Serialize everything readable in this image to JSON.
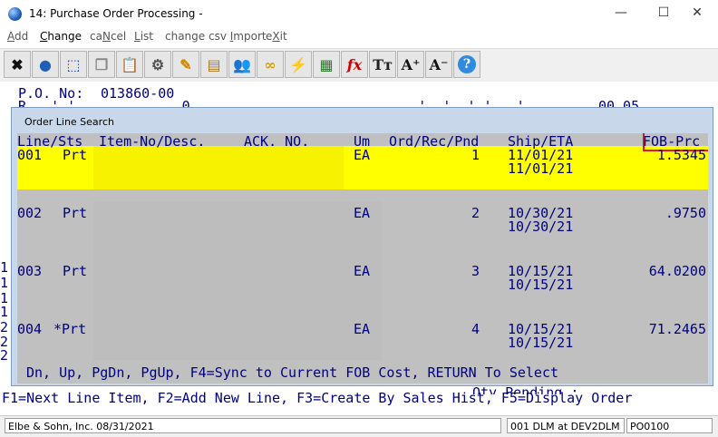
{
  "window": {
    "title": "14: Purchase Order Processing -",
    "minimize": "—",
    "maximize": "☐",
    "close": "✕"
  },
  "menu": [
    {
      "hot": "A",
      "rest": "dd"
    },
    {
      "hot": "C",
      "rest": "hange"
    },
    {
      "pre": "ca",
      "hot": "N",
      "rest": "cel"
    },
    {
      "hot": "L",
      "rest": "ist"
    },
    {
      "pre": "change csv ",
      "hot": "I",
      "rest": "mport"
    },
    {
      "pre": "e",
      "hot": "X",
      "rest": "it"
    }
  ],
  "toolbar": [
    {
      "name": "close-x-icon",
      "glyph": "✖",
      "color": "#111111"
    },
    {
      "name": "globe-icon",
      "glyph": "●",
      "color": "#1f5fb8"
    },
    {
      "name": "select-region-icon",
      "glyph": "⬚",
      "color": "#1a3fa8"
    },
    {
      "name": "copy-icon",
      "glyph": "❐",
      "color": "#888888"
    },
    {
      "name": "paste-icon",
      "glyph": "📋",
      "color": "#8a6a3a"
    },
    {
      "name": "gear-icon",
      "glyph": "⚙",
      "color": "#555555"
    },
    {
      "name": "pencil-icon",
      "glyph": "✎",
      "color": "#d48a00"
    },
    {
      "name": "notepad-icon",
      "glyph": "▤",
      "color": "#b07a20"
    },
    {
      "name": "users-icon",
      "glyph": "👥",
      "color": "#2d7fd0"
    },
    {
      "name": "chain-link-icon",
      "glyph": "∞",
      "color": "#d4a000"
    },
    {
      "name": "lightning-icon",
      "glyph": "⚡",
      "color": "#e0c000"
    },
    {
      "name": "spreadsheet-icon",
      "glyph": "▦",
      "color": "#2a7a2a"
    },
    {
      "name": "function-fx-icon",
      "glyph": "fx",
      "color": "#d00000"
    },
    {
      "name": "font-size-icon",
      "glyph": "Tт",
      "color": "#222222"
    },
    {
      "name": "font-increase-icon",
      "glyph": "A⁺",
      "color": "#111111"
    },
    {
      "name": "font-decrease-icon",
      "glyph": "A⁻",
      "color": "#111111"
    },
    {
      "name": "help-icon",
      "glyph": "?",
      "color": "#ffffff"
    }
  ],
  "terminal": {
    "po_label": "P.O. No:",
    "po_number": "013860-00",
    "partial_left": "R   ' '             0",
    "partial_right": "         '  '  ' '   '         00 05",
    "left_digits": [
      "1",
      "1",
      "1",
      "1",
      "2",
      "2",
      "2"
    ],
    "qty_pending": "Qty Pending :",
    "fkeys": "F1=Next Line Item, F2=Add New Line, F3=Create By Sales Hist, F5=Display Order"
  },
  "dialog": {
    "title": "Order Line Search",
    "headers": {
      "line": "Line/Sts",
      "item": "Item-No/Desc.",
      "ack": "ACK. NO.",
      "um": "Um",
      "qty": "Ord/Rec/Pnd",
      "ship": "Ship/ETA",
      "fob": "FOB-Prc"
    },
    "rows": [
      {
        "line": "001",
        "sts": "Prt",
        "um": "EA",
        "qty": "1",
        "ship": "11/01/21",
        "eta": "11/01/21",
        "fob": "1.5345"
      },
      {
        "line": "002",
        "sts": "Prt",
        "um": "EA",
        "qty": "2",
        "ship": "10/30/21",
        "eta": "10/30/21",
        "fob": ".9750"
      },
      {
        "line": "003",
        "sts": "Prt",
        "um": "EA",
        "qty": "3",
        "ship": "10/15/21",
        "eta": "10/15/21",
        "fob": "64.0200"
      },
      {
        "line": "004",
        "sts": "*Prt",
        "um": "EA",
        "qty": "4",
        "ship": "10/15/21",
        "eta": "10/15/21",
        "fob": "71.2465"
      }
    ],
    "footer": "Dn, Up, PgDn, PgUp, F4=Sync to Current FOB Cost, RETURN To Select"
  },
  "status": {
    "company": "Elbe & Sohn, Inc. 08/31/2021",
    "session": "001 DLM at DEV2DLM",
    "program": "PO0100"
  },
  "colors": {
    "highlight": "#ffff00",
    "terminal_text": "#000080",
    "annotation": "#e0141e"
  }
}
